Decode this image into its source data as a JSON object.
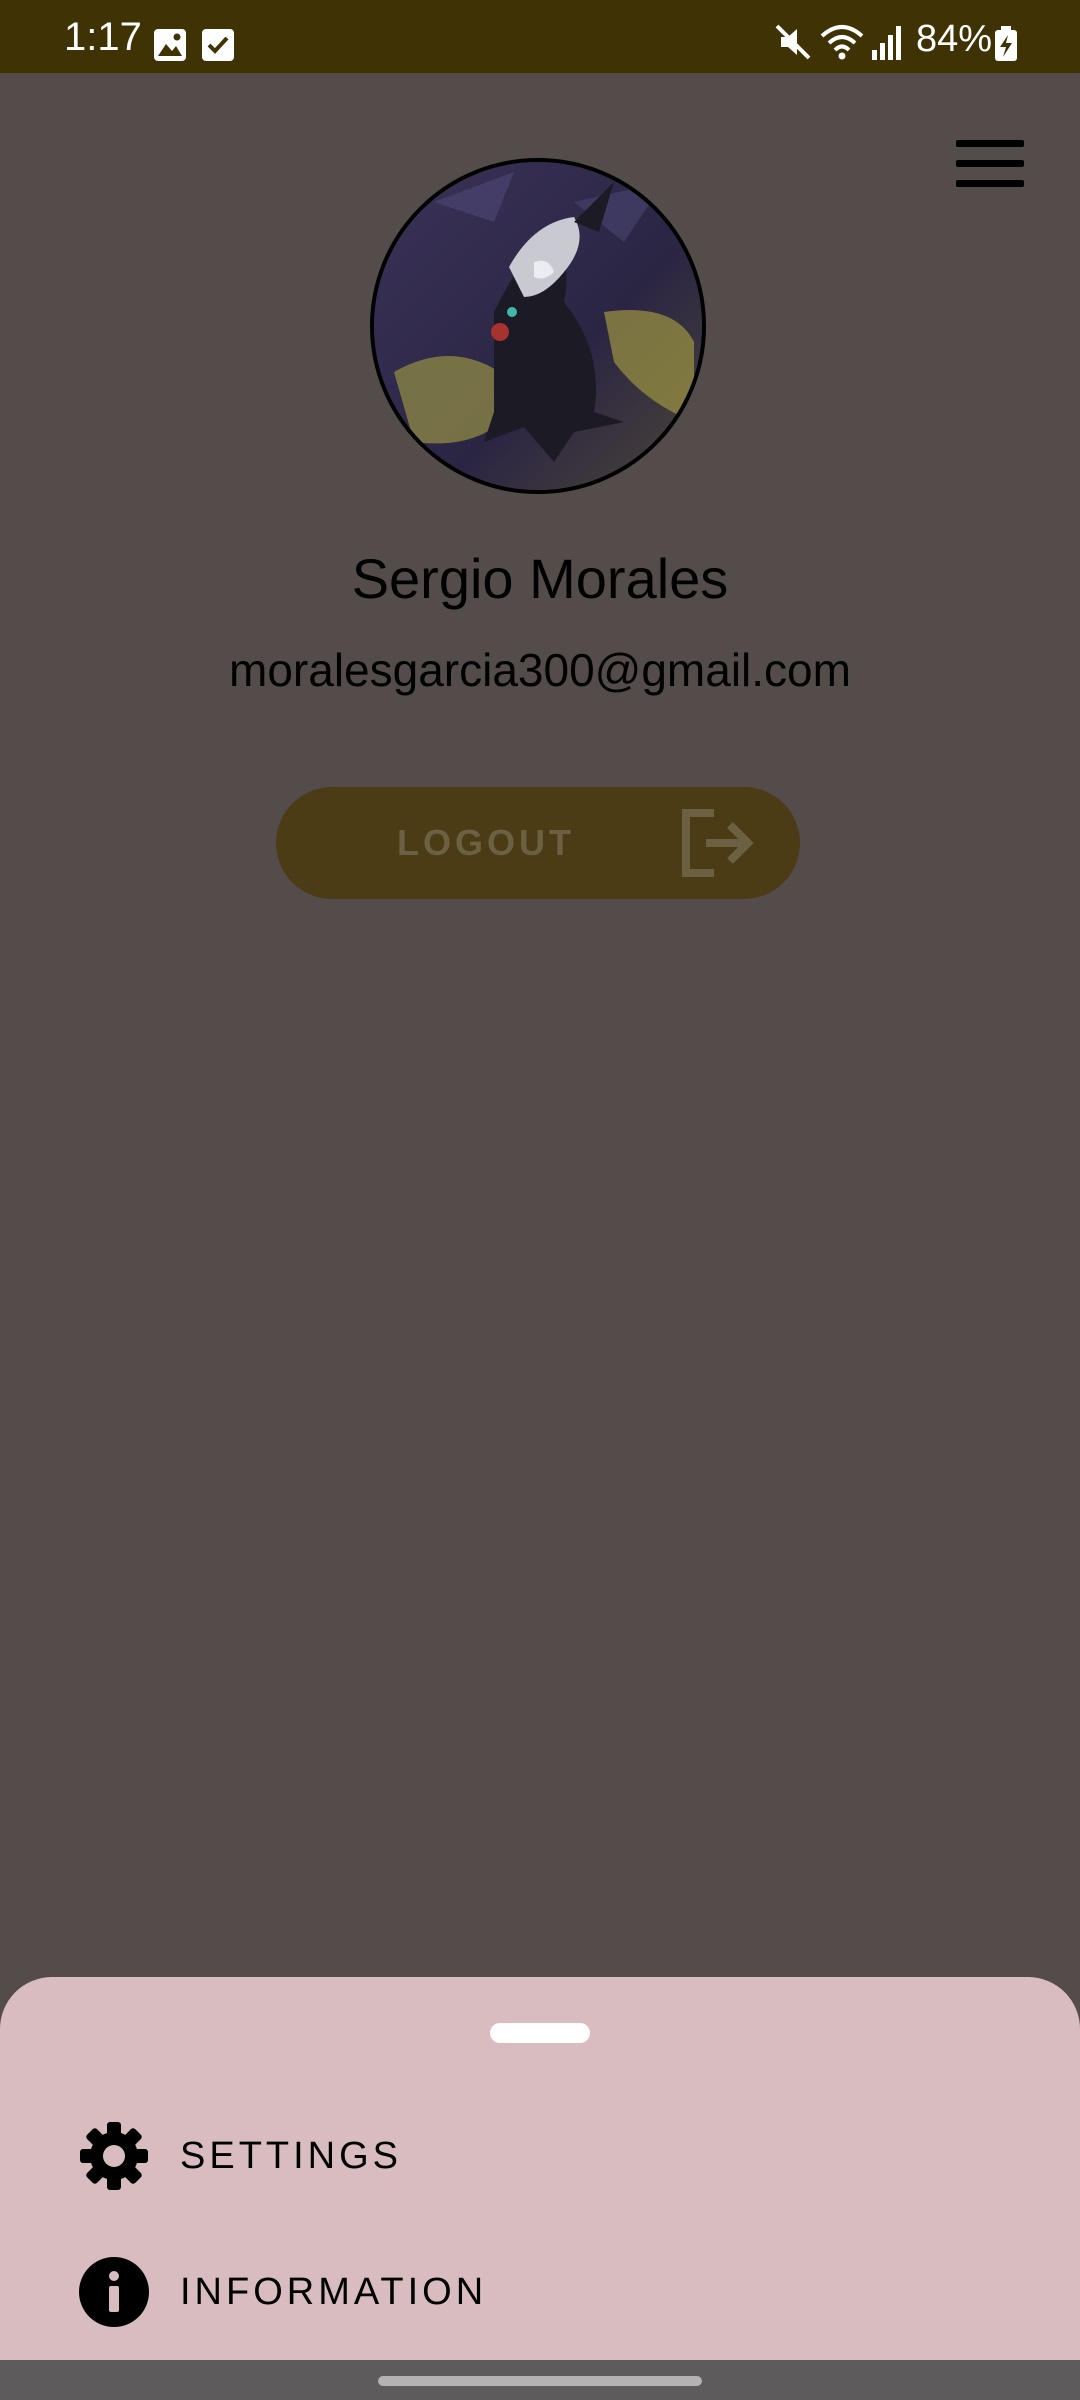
{
  "status_bar": {
    "time": "1:17",
    "battery": "84%",
    "icons": [
      "gallery-icon",
      "checkbox-icon",
      "mute-icon",
      "wifi-icon",
      "signal-icon",
      "battery-charging-icon"
    ]
  },
  "header": {
    "menu_icon": "hamburger-menu-icon"
  },
  "profile": {
    "name": "Sergio Morales",
    "email": "moralesgarcia300@gmail.com",
    "avatar": "avatar-image"
  },
  "logout": {
    "label": "LOGOUT",
    "icon": "logout-icon"
  },
  "bottom_sheet": {
    "items": [
      {
        "label": "SETTINGS",
        "icon": "gear-icon"
      },
      {
        "label": "INFORMATION",
        "icon": "info-icon"
      }
    ]
  },
  "colors": {
    "status_bar": "#3f3204",
    "page_background": "#544c4b",
    "logout_button": "#4b3c15",
    "sheet_background": "#d8bcbf",
    "nav_bar": "#5d5b5b"
  }
}
